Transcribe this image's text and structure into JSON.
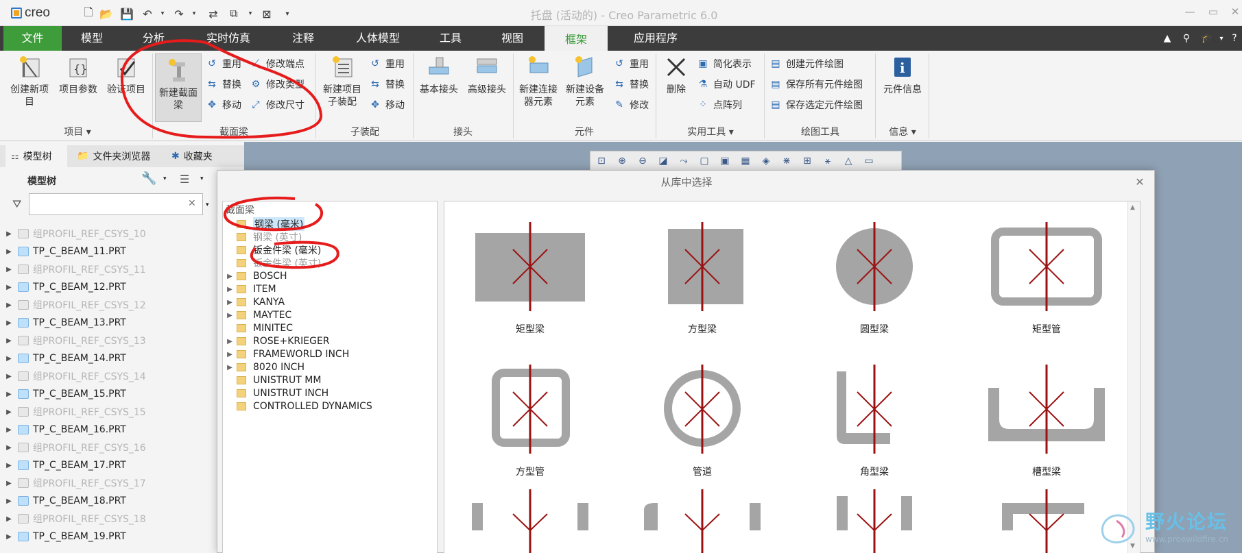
{
  "titlebar": {
    "logo_text": "creo",
    "window_title": "托盘 (活动的) - Creo Parametric 6.0",
    "quick_access_icons": [
      "new-icon",
      "open-icon",
      "save-icon",
      "undo-icon",
      "redo-icon",
      "regenerate-icon",
      "windows-icon",
      "close-window-icon",
      "customize-icon"
    ],
    "window_controls": [
      "minimize",
      "maximize",
      "close"
    ]
  },
  "menubar": {
    "tabs": [
      "文件",
      "模型",
      "分析",
      "实时仿真",
      "注释",
      "人体模型",
      "工具",
      "视图",
      "框架",
      "应用程序"
    ],
    "active_tab": "框架",
    "accent": "#3e9d3a"
  },
  "ribbon": {
    "groups": [
      {
        "label": "项目",
        "buttons": [
          "创建新项\n目",
          "项目参数",
          "验证项目"
        ]
      },
      {
        "label": "截面梁",
        "big": "新建截面\n梁",
        "small": [
          "重用",
          "替换",
          "移动",
          "修改端点",
          "修改类型",
          "修改尺寸"
        ]
      },
      {
        "label": "子装配",
        "big": "新建项目\n子装配",
        "small": [
          "重用",
          "替换",
          "移动"
        ]
      },
      {
        "label": "接头",
        "buttons": [
          "基本接头",
          "高级接头"
        ]
      },
      {
        "label": "元件",
        "buttons": [
          "新建连接\n器元素",
          "新建设备\n元素"
        ],
        "small": [
          "重用",
          "替换",
          "修改"
        ]
      },
      {
        "label": "实用工具",
        "buttons": [
          "删除"
        ],
        "small": [
          "简化表示",
          "自动 UDF",
          "点阵列"
        ]
      },
      {
        "label": "绘图工具",
        "small": [
          "创建元件绘图",
          "保存所有元件绘图",
          "保存选定元件绘图"
        ]
      },
      {
        "label": "信息",
        "buttons": [
          "元件信息"
        ]
      }
    ],
    "labels": {
      "g1_b1": "创建新项",
      "g1_b1b": "目",
      "g1_b2": "项目参数",
      "g1_b3": "验证项目",
      "g1": "项目",
      "g2_big": "新建截面",
      "g2_bigb": "梁",
      "g2_s1": "重用",
      "g2_s2": "替换",
      "g2_s3": "移动",
      "g2_s4": "修改端点",
      "g2_s5": "修改类型",
      "g2_s6": "修改尺寸",
      "g2": "截面梁",
      "g3_big": "新建项目",
      "g3_bigb": "子装配",
      "g3_s1": "重用",
      "g3_s2": "替换",
      "g3_s3": "移动",
      "g3": "子装配",
      "g4_b1": "基本接头",
      "g4_b2": "高级接头",
      "g4": "接头",
      "g5_b1": "新建连接",
      "g5_b1b": "器元素",
      "g5_b2": "新建设备",
      "g5_b2b": "元素",
      "g5_s1": "重用",
      "g5_s2": "替换",
      "g5_s3": "修改",
      "g5": "元件",
      "g6_b1": "删除",
      "g6_s1": "简化表示",
      "g6_s2": "自动 UDF",
      "g6_s3": "点阵列",
      "g6": "实用工具",
      "g7_s1": "创建元件绘图",
      "g7_s2": "保存所有元件绘图",
      "g7_s3": "保存选定元件绘图",
      "g7": "绘图工具",
      "g8_b1": "元件信息",
      "g8": "信息"
    }
  },
  "sidepanel": {
    "tabs": [
      "模型树",
      "文件夹浏览器",
      "收藏夹"
    ],
    "header": "模型树",
    "search_placeholder": "",
    "rows": [
      {
        "text": "组PROFIL_REF_CSYS_10",
        "dim": true
      },
      {
        "text": "TP_C_BEAM_11.PRT",
        "dim": false
      },
      {
        "text": "组PROFIL_REF_CSYS_11",
        "dim": true
      },
      {
        "text": "TP_C_BEAM_12.PRT",
        "dim": false
      },
      {
        "text": "组PROFIL_REF_CSYS_12",
        "dim": true
      },
      {
        "text": "TP_C_BEAM_13.PRT",
        "dim": false
      },
      {
        "text": "组PROFIL_REF_CSYS_13",
        "dim": true
      },
      {
        "text": "TP_C_BEAM_14.PRT",
        "dim": false
      },
      {
        "text": "组PROFIL_REF_CSYS_14",
        "dim": true
      },
      {
        "text": "TP_C_BEAM_15.PRT",
        "dim": false
      },
      {
        "text": "组PROFIL_REF_CSYS_15",
        "dim": true
      },
      {
        "text": "TP_C_BEAM_16.PRT",
        "dim": false
      },
      {
        "text": "组PROFIL_REF_CSYS_16",
        "dim": true
      },
      {
        "text": "TP_C_BEAM_17.PRT",
        "dim": false
      },
      {
        "text": "组PROFIL_REF_CSYS_17",
        "dim": true
      },
      {
        "text": "TP_C_BEAM_18.PRT",
        "dim": false
      },
      {
        "text": "组PROFIL_REF_CSYS_18",
        "dim": true
      },
      {
        "text": "TP_C_BEAM_19.PRT",
        "dim": false
      }
    ]
  },
  "dialog": {
    "title": "从库中选择",
    "root_label": "截面梁",
    "categories": [
      {
        "label": "钢梁 (毫米)",
        "expandable": false,
        "selected": true
      },
      {
        "label": "钢梁 (英寸)",
        "expandable": false,
        "selected": false
      },
      {
        "label": "钣金件梁 (毫米)",
        "expandable": false,
        "selected": false
      },
      {
        "label": "钣金件梁 (英寸)",
        "expandable": false,
        "selected": false
      },
      {
        "label": "BOSCH",
        "expandable": true
      },
      {
        "label": "ITEM",
        "expandable": true
      },
      {
        "label": "KANYA",
        "expandable": true
      },
      {
        "label": "MAYTEC",
        "expandable": true
      },
      {
        "label": "MINITEC",
        "expandable": false
      },
      {
        "label": "ROSE+KRIEGER",
        "expandable": true
      },
      {
        "label": "FRAMEWORLD INCH",
        "expandable": true
      },
      {
        "label": "8020 INCH",
        "expandable": true
      },
      {
        "label": "UNISTRUT MM",
        "expandable": false
      },
      {
        "label": "UNISTRUT INCH",
        "expandable": false
      },
      {
        "label": "CONTROLLED DYNAMICS",
        "expandable": false
      }
    ],
    "profiles": [
      {
        "shape": "rect-bar",
        "label": "矩型梁"
      },
      {
        "shape": "square-bar",
        "label": "方型梁"
      },
      {
        "shape": "round-bar",
        "label": "圆型梁"
      },
      {
        "shape": "rect-tube",
        "label": "矩型管"
      },
      {
        "shape": "square-tube",
        "label": "方型管"
      },
      {
        "shape": "pipe",
        "label": "管道"
      },
      {
        "shape": "angle",
        "label": "角型梁"
      },
      {
        "shape": "channel",
        "label": "槽型梁"
      }
    ],
    "colors": {
      "profile_fill": "#a5a5a5",
      "axis_line": "#9b1111"
    }
  },
  "watermark": {
    "text": "野火论坛",
    "url": "www.proewildfire.cn"
  }
}
